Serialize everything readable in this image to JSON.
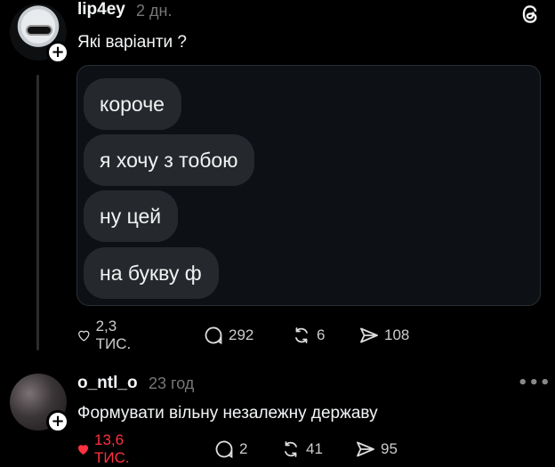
{
  "posts": [
    {
      "username": "lip4ey",
      "time": "2 дн.",
      "text": "Які варіанти ?",
      "follow_label": "+",
      "screenshot": {
        "messages": [
          "короче",
          "я хочу з тобою",
          "ну цей",
          "на букву ф"
        ]
      },
      "actions": {
        "likes": "2,3 ТИС.",
        "comments": "292",
        "reposts": "6",
        "shares": "108"
      },
      "liked": false
    },
    {
      "username": "o_ntl_o",
      "time": "23 год",
      "text": "Формувати вільну незалежну державу",
      "follow_label": "+",
      "more_label": "•••",
      "actions": {
        "likes": "13,6 ТИС.",
        "comments": "2",
        "reposts": "41",
        "shares": "95"
      },
      "liked": true
    }
  ],
  "icons": {
    "app": "threads-icon",
    "like": "heart-icon",
    "comment": "comment-icon",
    "repost": "repost-icon",
    "share": "send-icon"
  },
  "colors": {
    "background": "#000000",
    "like_active": "#ff3040",
    "bubble": "#25292e"
  }
}
